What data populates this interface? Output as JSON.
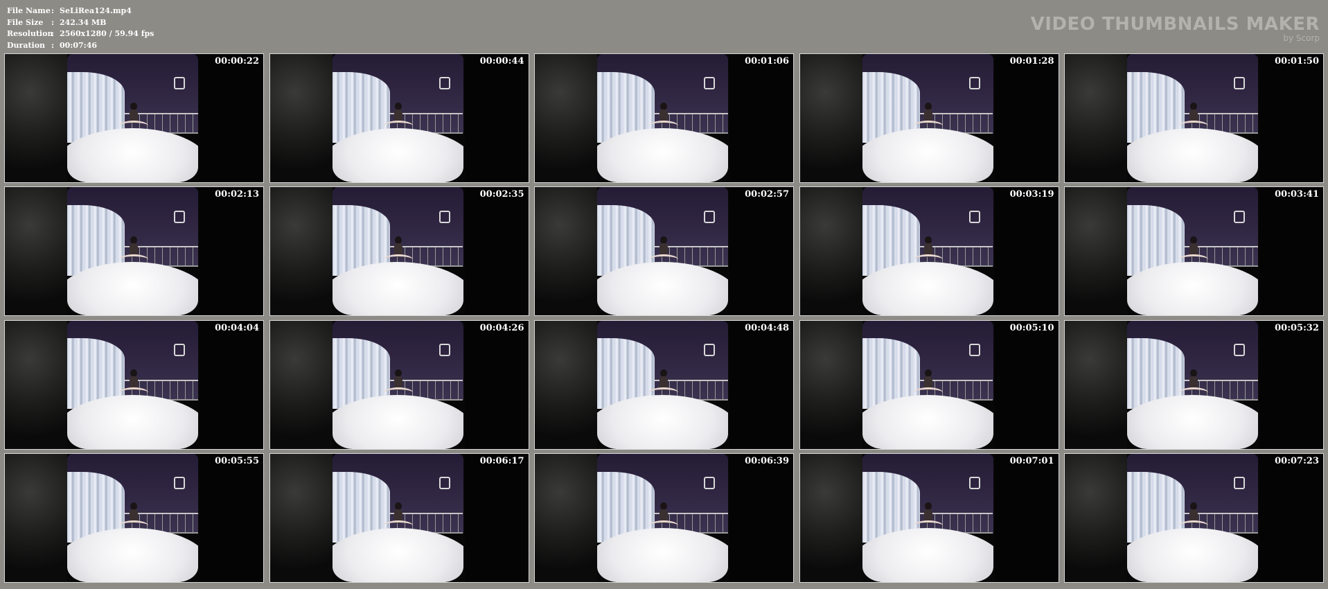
{
  "info": {
    "rows": [
      {
        "label": "File Name",
        "value": "SeLiRea124.mp4"
      },
      {
        "label": "File Size",
        "value": "242.34 MB"
      },
      {
        "label": "Resolution",
        "value": "2560x1280 / 59.94 fps"
      },
      {
        "label": "Duration",
        "value": "00:07:46"
      }
    ],
    "separator": ":"
  },
  "brand": {
    "title": "VIDEO THUMBNAILS MAKER",
    "subtitle": "by Scorp"
  },
  "thumbnails": [
    {
      "time": "00:00:22"
    },
    {
      "time": "00:00:44"
    },
    {
      "time": "00:01:06"
    },
    {
      "time": "00:01:28"
    },
    {
      "time": "00:01:50"
    },
    {
      "time": "00:02:13"
    },
    {
      "time": "00:02:35"
    },
    {
      "time": "00:02:57"
    },
    {
      "time": "00:03:19"
    },
    {
      "time": "00:03:41"
    },
    {
      "time": "00:04:04"
    },
    {
      "time": "00:04:26"
    },
    {
      "time": "00:04:48"
    },
    {
      "time": "00:05:10"
    },
    {
      "time": "00:05:32"
    },
    {
      "time": "00:05:55"
    },
    {
      "time": "00:06:17"
    },
    {
      "time": "00:06:39"
    },
    {
      "time": "00:07:01"
    },
    {
      "time": "00:07:23"
    }
  ],
  "colors": {
    "background": "#8c8b86",
    "brand": "#b3b2ad",
    "text": "#ffffff"
  }
}
